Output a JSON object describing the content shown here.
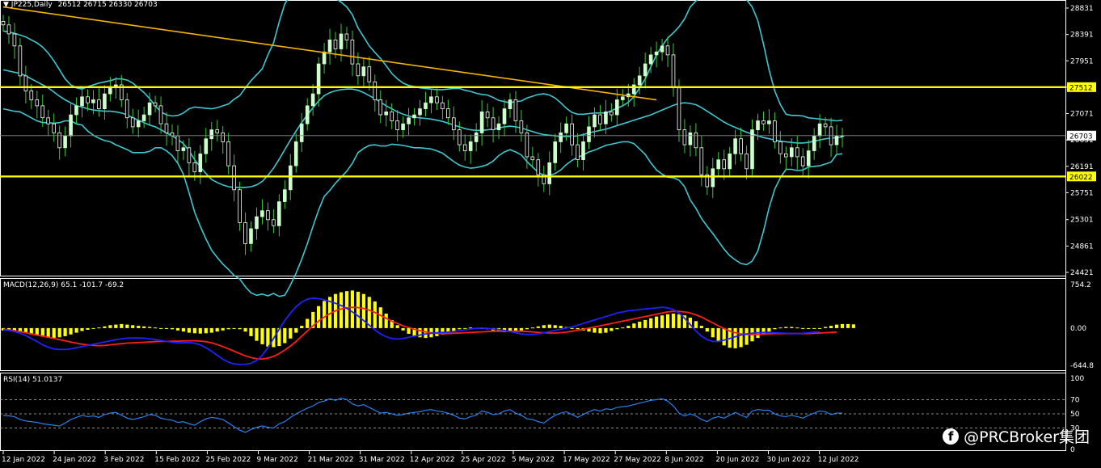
{
  "header": {
    "symbol_label": "JP225,Daily",
    "ohlc_label": "26512 26715 26330 26703",
    "macd_label": "MACD(12,26,9) 65.1 -101.7 -69.2",
    "rsi_label": "RSI(14) 51.0137"
  },
  "watermark": "@PRCBroker集团",
  "colors": {
    "background": "#000000",
    "bull_candle": "#ccffcc",
    "bear_candle": "#ffffff",
    "wick": "#3cc83c",
    "bollinger": "#3ec8d2",
    "trendline": "#f4b400",
    "horizontal_level": "#ffff00",
    "macd_hist": "#ffff00",
    "macd_line": "#1e22ff",
    "signal_line": "#ff1e1e",
    "rsi_line": "#2a8aff",
    "tag_highlight": "#ffff00"
  },
  "chart_data": [
    {
      "type": "candlestick",
      "name": "price",
      "yaxis_ticks": [
        "28831",
        "28391",
        "27951",
        "27512",
        "27071",
        "26631",
        "26191",
        "25751",
        "25301",
        "24861",
        "24421"
      ],
      "ylim": [
        24421,
        28831
      ],
      "current_price": 26703,
      "current_price_label": "26703",
      "levels": [
        {
          "value": 27512,
          "label": "27512"
        },
        {
          "value": 26022,
          "label": "26022"
        }
      ],
      "trendline": {
        "from": [
          "2022-01-12",
          28850
        ],
        "to": [
          "2022-06-08",
          27300
        ]
      },
      "xaxis_ticks": [
        "12 Jan 2022",
        "24 Jan 2022",
        "3 Feb 2022",
        "15 Feb 2022",
        "25 Feb 2022",
        "9 Mar 2022",
        "21 Mar 2022",
        "31 Mar 2022",
        "12 Apr 2022",
        "25 Apr 2022",
        "5 May 2022",
        "17 May 2022",
        "27 May 2022",
        "8 Jun 2022",
        "20 Jun 2022",
        "30 Jun 2022",
        "12 Jul 2022"
      ],
      "close": [
        28550,
        28400,
        28200,
        27700,
        27450,
        27300,
        27200,
        27000,
        26900,
        26750,
        26500,
        26700,
        27050,
        27200,
        27350,
        27250,
        27300,
        27150,
        27400,
        27500,
        27550,
        27300,
        27000,
        26850,
        26950,
        27050,
        27250,
        27200,
        26900,
        26750,
        26700,
        26450,
        26500,
        26250,
        26100,
        26400,
        26650,
        26800,
        26750,
        26600,
        26200,
        25800,
        25250,
        24900,
        25150,
        25350,
        25450,
        25300,
        25200,
        25600,
        25800,
        26200,
        26600,
        26900,
        27200,
        27400,
        27900,
        28100,
        28300,
        28150,
        28400,
        28300,
        27900,
        27700,
        27850,
        27600,
        27300,
        27050,
        27100,
        26950,
        26800,
        26900,
        27000,
        27050,
        27150,
        27250,
        27350,
        27250,
        27150,
        27000,
        26800,
        26550,
        26450,
        26600,
        26750,
        27100,
        27000,
        26800,
        26900,
        27150,
        27300,
        26950,
        26750,
        26350,
        26300,
        26050,
        25900,
        26250,
        26600,
        26750,
        26900,
        26550,
        26300,
        26600,
        26850,
        27050,
        26900,
        27100,
        27050,
        27300,
        27350,
        27400,
        27550,
        27700,
        27900,
        28050,
        28100,
        28200,
        28050,
        27500,
        26800,
        26550,
        26750,
        26500,
        26050,
        25850,
        26150,
        26300,
        26150,
        26400,
        26650,
        26400,
        26150,
        26800,
        26950,
        26900,
        26950,
        26600,
        26400,
        26350,
        26500,
        26350,
        26200,
        26450,
        26700,
        26900,
        26850,
        26550,
        26700,
        26703
      ],
      "upper_band": [
        28450,
        28430,
        28410,
        28380,
        28350,
        28300,
        28250,
        28180,
        28080,
        27950,
        27800,
        27650,
        27550,
        27500,
        27480,
        27520,
        27550,
        27580,
        27600,
        27620,
        27650,
        27650,
        27630,
        27580,
        27500,
        27420,
        27320,
        27200,
        27100,
        27050,
        27030,
        27040,
        27080,
        27150,
        27180,
        27170,
        27160,
        27150,
        27170,
        27200,
        27230,
        27310,
        27370,
        27500,
        27620,
        27720,
        27820,
        28050,
        28250,
        28600,
        28900,
        29050,
        29150,
        29200,
        29200,
        29150,
        29100,
        29050,
        29050,
        28990,
        28930,
        28850,
        28720,
        28500,
        28350,
        28200,
        28090,
        27990,
        27870,
        27740,
        27650,
        27580,
        27540,
        27520,
        27500,
        27490,
        27480,
        27470,
        27470,
        27480,
        27490,
        27490,
        27460,
        27440,
        27410,
        27390,
        27380,
        27340,
        27290,
        27270,
        27250,
        27270,
        27280,
        27330,
        27360,
        27390,
        27400,
        27380,
        27330,
        27250,
        27160,
        27090,
        27060,
        27060,
        27070,
        27080,
        27080,
        27080,
        27120,
        27160,
        27200,
        27260,
        27350,
        27500,
        27650,
        27850,
        28050,
        28200,
        28330,
        28420,
        28520,
        28650,
        28850,
        28950,
        29020,
        29030,
        29030,
        29040,
        29050,
        29060,
        29050,
        29030,
        28970,
        28850,
        28620,
        28230,
        27800,
        27450,
        27220,
        27060,
        27040,
        27040,
        27030,
        27000,
        26990,
        26980,
        26970,
        26960,
        26950,
        26960
      ],
      "middle_band": [
        27800,
        27780,
        27760,
        27740,
        27700,
        27650,
        27600,
        27550,
        27500,
        27430,
        27360,
        27300,
        27250,
        27200,
        27180,
        27150,
        27130,
        27120,
        27110,
        27110,
        27100,
        27080,
        27050,
        27000,
        26960,
        26920,
        26880,
        26850,
        26800,
        26750,
        26700,
        26640,
        26570,
        26450,
        26300,
        26180,
        26070,
        25970,
        25920,
        25880,
        25850,
        25840,
        25840,
        25840,
        25850,
        25880,
        25940,
        26040,
        26160,
        26310,
        26470,
        26630,
        26780,
        26920,
        27050,
        27170,
        27280,
        27370,
        27420,
        27450,
        27470,
        27480,
        27480,
        27460,
        27420,
        27370,
        27320,
        27260,
        27200,
        27150,
        27100,
        27060,
        27030,
        27010,
        27000,
        26990,
        26980,
        26960,
        26940,
        26910,
        26880,
        26850,
        26820,
        26800,
        26790,
        26790,
        26800,
        26810,
        26830,
        26850,
        26860,
        26850,
        26830,
        26800,
        26770,
        26740,
        26720,
        26710,
        26700,
        26690,
        26690,
        26690,
        26700,
        26720,
        26750,
        26770,
        26790,
        26810,
        26840,
        26870,
        26900,
        26930,
        26960,
        26990,
        27020,
        27050,
        27090,
        27130,
        27170,
        27210,
        27240,
        27250,
        27240,
        27220,
        27170,
        27110,
        27050,
        26990,
        26930,
        26880,
        26840,
        26800,
        26760,
        26730,
        26700,
        26670,
        26650,
        26630,
        26610,
        26600,
        26590,
        26580,
        26580,
        26590,
        26610,
        26630,
        26650,
        26660,
        26670,
        26680
      ],
      "lower_band": [
        27150,
        27130,
        27110,
        27100,
        27050,
        27000,
        26950,
        26920,
        26920,
        26910,
        26920,
        26950,
        26950,
        26900,
        26880,
        26780,
        26710,
        26660,
        26620,
        26600,
        26550,
        26510,
        26470,
        26420,
        26420,
        26420,
        26440,
        26500,
        26500,
        26450,
        26370,
        26240,
        26060,
        25750,
        25420,
        25190,
        24980,
        24790,
        24670,
        24560,
        24470,
        24370,
        24310,
        24180,
        24080,
        24040,
        24060,
        24030,
        24070,
        24020,
        24040,
        24210,
        24410,
        24640,
        24900,
        25190,
        25460,
        25690,
        25790,
        25910,
        26010,
        26110,
        26240,
        26420,
        26490,
        26540,
        26550,
        26530,
        26530,
        26560,
        26550,
        26540,
        26520,
        26500,
        26500,
        26490,
        26480,
        26450,
        26410,
        26340,
        26270,
        26210,
        26180,
        26160,
        26170,
        26190,
        26220,
        26280,
        26370,
        26430,
        26470,
        26430,
        26380,
        26270,
        26180,
        26090,
        26040,
        26040,
        26070,
        26130,
        26220,
        26290,
        26340,
        26380,
        26430,
        26460,
        26500,
        26540,
        26560,
        26580,
        26600,
        26600,
        26570,
        26480,
        26390,
        26250,
        26130,
        26060,
        26010,
        26000,
        25960,
        25850,
        25630,
        25490,
        25320,
        25190,
        25070,
        24940,
        24810,
        24700,
        24630,
        24570,
        24550,
        24610,
        24780,
        25110,
        25500,
        25810,
        26000,
        26140,
        26140,
        26120,
        26130,
        26180,
        26190,
        26200,
        26230,
        26260,
        26390,
        26400
      ]
    },
    {
      "type": "bar+line",
      "name": "MACD(12,26,9)",
      "yaxis_ticks": [
        "754.2",
        "0.00",
        "-644.8"
      ],
      "ylim": [
        -644.8,
        754.2
      ],
      "histogram": [
        -40,
        -50,
        -60,
        -70,
        -90,
        -110,
        -130,
        -150,
        -160,
        -170,
        -160,
        -140,
        -110,
        -80,
        -50,
        -30,
        -10,
        10,
        30,
        50,
        60,
        70,
        60,
        50,
        40,
        30,
        20,
        10,
        0,
        -10,
        -20,
        -40,
        -60,
        -80,
        -90,
        -95,
        -90,
        -80,
        -60,
        -40,
        -20,
        0,
        -20,
        -60,
        -140,
        -220,
        -280,
        -320,
        -330,
        -310,
        -260,
        -180,
        -80,
        40,
        160,
        280,
        380,
        470,
        540,
        590,
        620,
        640,
        650,
        630,
        590,
        540,
        460,
        360,
        250,
        140,
        50,
        -40,
        -100,
        -140,
        -160,
        -170,
        -160,
        -140,
        -110,
        -80,
        -50,
        -20,
        0,
        10,
        0,
        -10,
        -20,
        -40,
        -60,
        -70,
        -70,
        -60,
        -40,
        -20,
        10,
        30,
        50,
        60,
        50,
        40,
        20,
        0,
        -20,
        -40,
        -60,
        -80,
        -90,
        -80,
        -50,
        -20,
        10,
        40,
        80,
        110,
        140,
        170,
        200,
        220,
        240,
        250,
        240,
        220,
        180,
        120,
        40,
        -60,
        -160,
        -240,
        -300,
        -340,
        -350,
        -330,
        -290,
        -230,
        -170,
        -110,
        -60,
        -20,
        10,
        20,
        20,
        10,
        0,
        -10,
        -10,
        0,
        20,
        40,
        60,
        70,
        70,
        65
      ],
      "macd_line": [
        -30,
        -40,
        -60,
        -90,
        -130,
        -180,
        -230,
        -290,
        -330,
        -360,
        -370,
        -370,
        -360,
        -340,
        -320,
        -300,
        -280,
        -260,
        -240,
        -220,
        -200,
        -185,
        -175,
        -170,
        -170,
        -175,
        -185,
        -200,
        -215,
        -230,
        -245,
        -255,
        -255,
        -250,
        -260,
        -290,
        -340,
        -400,
        -470,
        -540,
        -590,
        -620,
        -630,
        -625,
        -610,
        -560,
        -470,
        -340,
        -180,
        -20,
        130,
        260,
        370,
        450,
        500,
        520,
        510,
        490,
        460,
        430,
        390,
        340,
        280,
        210,
        130,
        50,
        -30,
        -100,
        -150,
        -180,
        -190,
        -180,
        -160,
        -140,
        -120,
        -100,
        -90,
        -80,
        -75,
        -70,
        -60,
        -45,
        -30,
        -15,
        -5,
        0,
        -5,
        -15,
        -25,
        -40,
        -60,
        -80,
        -100,
        -110,
        -110,
        -100,
        -80,
        -60,
        -40,
        -20,
        0,
        20,
        50,
        80,
        110,
        140,
        170,
        200,
        230,
        260,
        280,
        300,
        310,
        320,
        330,
        340,
        350,
        360,
        350,
        320,
        260,
        170,
        60,
        -50,
        -140,
        -200,
        -230,
        -230,
        -210,
        -180,
        -150,
        -120,
        -100,
        -90,
        -80,
        -75,
        -75,
        -80,
        -85,
        -90,
        -95,
        -95,
        -90,
        -80,
        -70,
        -65
      ],
      "signal_line": [
        -20,
        -30,
        -45,
        -60,
        -80,
        -100,
        -120,
        -140,
        -160,
        -180,
        -200,
        -220,
        -240,
        -260,
        -280,
        -290,
        -300,
        -305,
        -300,
        -290,
        -280,
        -270,
        -260,
        -255,
        -250,
        -245,
        -240,
        -235,
        -232,
        -230,
        -228,
        -225,
        -222,
        -220,
        -220,
        -225,
        -235,
        -255,
        -285,
        -320,
        -360,
        -400,
        -440,
        -480,
        -510,
        -530,
        -535,
        -520,
        -490,
        -440,
        -380,
        -310,
        -230,
        -140,
        -50,
        40,
        120,
        190,
        250,
        300,
        330,
        350,
        360,
        355,
        340,
        310,
        270,
        220,
        170,
        120,
        80,
        40,
        10,
        -20,
        -45,
        -65,
        -80,
        -90,
        -95,
        -95,
        -90,
        -85,
        -80,
        -75,
        -70,
        -65,
        -60,
        -55,
        -55,
        -55,
        -55,
        -55,
        -55,
        -60,
        -65,
        -75,
        -80,
        -85,
        -85,
        -80,
        -70,
        -55,
        -40,
        -20,
        0,
        20,
        40,
        60,
        80,
        100,
        120,
        140,
        160,
        180,
        200,
        220,
        240,
        260,
        280,
        290,
        290,
        280,
        260,
        230,
        190,
        140,
        90,
        40,
        -10,
        -50,
        -80,
        -100,
        -110,
        -115,
        -110,
        -105,
        -100,
        -95,
        -95,
        -95,
        -95,
        -95,
        -95,
        -95,
        -90,
        -85,
        -80,
        -75,
        -70
      ]
    },
    {
      "type": "line",
      "name": "RSI(14)",
      "yaxis_ticks": [
        "100",
        "70",
        "50",
        "30",
        "0"
      ],
      "ylim": [
        0,
        100
      ],
      "levels": [
        70,
        50,
        30
      ],
      "values": [
        48,
        47,
        46,
        42,
        40,
        39,
        38,
        36,
        35,
        34,
        33,
        37,
        42,
        45,
        48,
        46,
        47,
        45,
        49,
        51,
        52,
        48,
        44,
        42,
        44,
        46,
        49,
        48,
        44,
        42,
        41,
        38,
        39,
        36,
        34,
        39,
        43,
        45,
        44,
        42,
        37,
        32,
        27,
        24,
        28,
        31,
        33,
        31,
        30,
        36,
        39,
        45,
        50,
        54,
        58,
        61,
        66,
        68,
        71,
        69,
        72,
        70,
        64,
        61,
        63,
        59,
        55,
        51,
        52,
        50,
        48,
        49,
        51,
        52,
        53,
        55,
        56,
        54,
        53,
        51,
        48,
        44,
        43,
        46,
        48,
        54,
        52,
        49,
        50,
        54,
        56,
        51,
        48,
        43,
        42,
        39,
        37,
        43,
        48,
        51,
        53,
        49,
        45,
        49,
        53,
        56,
        54,
        57,
        56,
        59,
        60,
        61,
        63,
        65,
        67,
        69,
        70,
        71,
        68,
        61,
        51,
        47,
        50,
        47,
        42,
        39,
        44,
        46,
        44,
        48,
        52,
        48,
        45,
        54,
        56,
        55,
        55,
        50,
        47,
        46,
        48,
        46,
        44,
        48,
        51,
        54,
        53,
        49,
        51,
        51
      ]
    }
  ]
}
